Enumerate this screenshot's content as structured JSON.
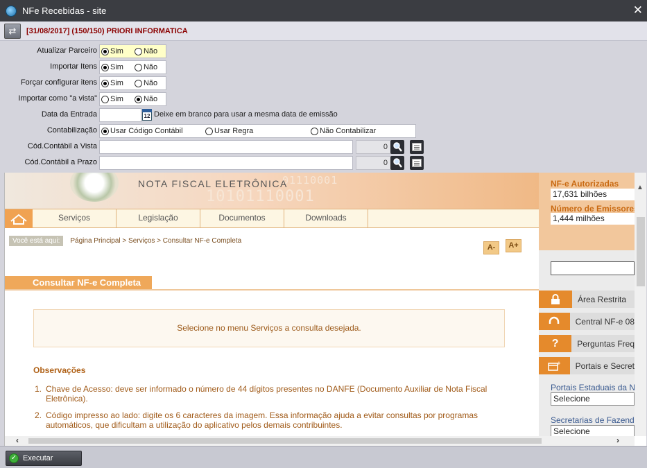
{
  "window": {
    "title": "NFe Recebidas - site",
    "close_icon": "close-icon"
  },
  "header": {
    "company": "[31/08/2017] (150/150) PRIORI INFORMATICA"
  },
  "form": {
    "atualizar_parceiro": {
      "label": "Atualizar Parceiro",
      "opt1": "Sim",
      "opt2": "Não",
      "selected": "Sim"
    },
    "importar_itens": {
      "label": "Importar Itens",
      "opt1": "Sim",
      "opt2": "Não",
      "selected": "Sim"
    },
    "forcar_configurar": {
      "label": "Forçar configurar itens",
      "opt1": "Sim",
      "opt2": "Não",
      "selected": "Sim"
    },
    "importar_vista": {
      "label": "Importar como \"a vista\"",
      "opt1": "Sim",
      "opt2": "Não",
      "selected": "Não"
    },
    "data_entrada": {
      "label": "Data da Entrada",
      "value": "",
      "calendar_day": "12",
      "hint": "Deixe em branco para usar a mesma data de emissão"
    },
    "contabilizacao": {
      "label": "Contabilização",
      "opt1": "Usar Código Contábil",
      "opt2": "Usar Regra",
      "opt3": "Não Contabilizar",
      "selected": "Usar Código Contábil"
    },
    "cod_vista": {
      "label": "Cód.Contábil a Vista",
      "value": "",
      "number": "0"
    },
    "cod_prazo": {
      "label": "Cód.Contábil a Prazo",
      "value": "",
      "number": "0"
    }
  },
  "browser": {
    "banner_title": "NOTA FISCAL ELETRÔNICA",
    "banner_binary_1": "10101110001",
    "banner_binary_2": "01110001",
    "nav": [
      "Serviços",
      "Legislação",
      "Documentos",
      "Downloads"
    ],
    "crumb_tag": "Você está aqui:",
    "crumb": "Página Principal > Serviços > Consultar NF-e Completa",
    "font_minus": "A-",
    "font_plus": "A+",
    "section_title": "Consultar NF-e Completa",
    "notice": "Selecione no menu Serviços a consulta desejada.",
    "obs_title": "Observações",
    "obs": [
      {
        "num": "1.",
        "text": "Chave de Acesso: deve ser informado o número de 44 dígitos presentes no DANFE (Documento Auxiliar de Nota Fiscal Eletrônica)."
      },
      {
        "num": "2.",
        "text": "Código impresso ao lado: digite os 6 caracteres da imagem. Essa informação ajuda a evitar consultas por programas automáticos, que dificultam a utilização do aplicativo pelos demais contribuintes."
      }
    ],
    "sidebar": {
      "stat1_label": "NF-e Autorizadas",
      "stat1_value": "17,631 bilhões",
      "stat2_label": "Número de Emissores",
      "stat2_value": "1,444 milhões",
      "btn1": "Área Restrita",
      "btn2": "Central NF-e 08",
      "btn3": "Perguntas Freq",
      "btn4": "Portais e Secret",
      "text1": "Portais Estaduais da N",
      "select1": "Selecione",
      "text2": "Secretarias de Fazenda",
      "select2": "Selecione"
    }
  },
  "footer": {
    "execute_label": "Executar"
  }
}
